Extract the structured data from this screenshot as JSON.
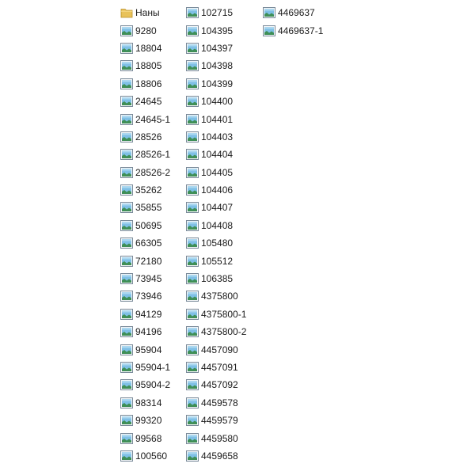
{
  "files": {
    "columns": [
      [
        {
          "name": "Наны",
          "icon": "folder-icon"
        },
        {
          "name": "9280",
          "icon": "image-file-icon"
        },
        {
          "name": "18804",
          "icon": "image-file-icon"
        },
        {
          "name": "18805",
          "icon": "image-file-icon"
        },
        {
          "name": "18806",
          "icon": "image-file-icon"
        },
        {
          "name": "24645",
          "icon": "image-file-icon"
        },
        {
          "name": "24645-1",
          "icon": "image-file-icon"
        },
        {
          "name": "28526",
          "icon": "image-file-icon"
        },
        {
          "name": "28526-1",
          "icon": "image-file-icon"
        },
        {
          "name": "28526-2",
          "icon": "image-file-icon"
        },
        {
          "name": "35262",
          "icon": "image-file-icon"
        },
        {
          "name": "35855",
          "icon": "image-file-icon"
        },
        {
          "name": "50695",
          "icon": "image-file-icon"
        },
        {
          "name": "66305",
          "icon": "image-file-icon"
        },
        {
          "name": "72180",
          "icon": "image-file-icon"
        },
        {
          "name": "73945",
          "icon": "image-file-icon"
        },
        {
          "name": "73946",
          "icon": "image-file-icon"
        },
        {
          "name": "94129",
          "icon": "image-file-icon"
        },
        {
          "name": "94196",
          "icon": "image-file-icon"
        },
        {
          "name": "95904",
          "icon": "image-file-icon"
        },
        {
          "name": "95904-1",
          "icon": "image-file-icon"
        },
        {
          "name": "95904-2",
          "icon": "image-file-icon"
        },
        {
          "name": "98314",
          "icon": "image-file-icon"
        },
        {
          "name": "99320",
          "icon": "image-file-icon"
        },
        {
          "name": "99568",
          "icon": "image-file-icon"
        },
        {
          "name": "100560",
          "icon": "image-file-icon"
        }
      ],
      [
        {
          "name": "102715",
          "icon": "image-file-icon"
        },
        {
          "name": "104395",
          "icon": "image-file-icon"
        },
        {
          "name": "104397",
          "icon": "image-file-icon"
        },
        {
          "name": "104398",
          "icon": "image-file-icon"
        },
        {
          "name": "104399",
          "icon": "image-file-icon"
        },
        {
          "name": "104400",
          "icon": "image-file-icon"
        },
        {
          "name": "104401",
          "icon": "image-file-icon"
        },
        {
          "name": "104403",
          "icon": "image-file-icon"
        },
        {
          "name": "104404",
          "icon": "image-file-icon"
        },
        {
          "name": "104405",
          "icon": "image-file-icon"
        },
        {
          "name": "104406",
          "icon": "image-file-icon"
        },
        {
          "name": "104407",
          "icon": "image-file-icon"
        },
        {
          "name": "104408",
          "icon": "image-file-icon"
        },
        {
          "name": "105480",
          "icon": "image-file-icon"
        },
        {
          "name": "105512",
          "icon": "image-file-icon"
        },
        {
          "name": "106385",
          "icon": "image-file-icon"
        },
        {
          "name": "4375800",
          "icon": "image-file-icon"
        },
        {
          "name": "4375800-1",
          "icon": "image-file-icon"
        },
        {
          "name": "4375800-2",
          "icon": "image-file-icon"
        },
        {
          "name": "4457090",
          "icon": "image-file-icon"
        },
        {
          "name": "4457091",
          "icon": "image-file-icon"
        },
        {
          "name": "4457092",
          "icon": "image-file-icon"
        },
        {
          "name": "4459578",
          "icon": "image-file-icon"
        },
        {
          "name": "4459579",
          "icon": "image-file-icon"
        },
        {
          "name": "4459580",
          "icon": "image-file-icon"
        },
        {
          "name": "4459658",
          "icon": "image-file-icon"
        }
      ],
      [
        {
          "name": "4469637",
          "icon": "image-file-icon"
        },
        {
          "name": "4469637-1",
          "icon": "image-file-icon"
        }
      ]
    ]
  },
  "colors": {
    "background": "#ffffff",
    "text": "#1a1a1a",
    "folder": "#e8c25a",
    "image_frame": "#7a8a99",
    "image_sky": "#7fc0e6",
    "image_ground": "#3f8f57"
  }
}
